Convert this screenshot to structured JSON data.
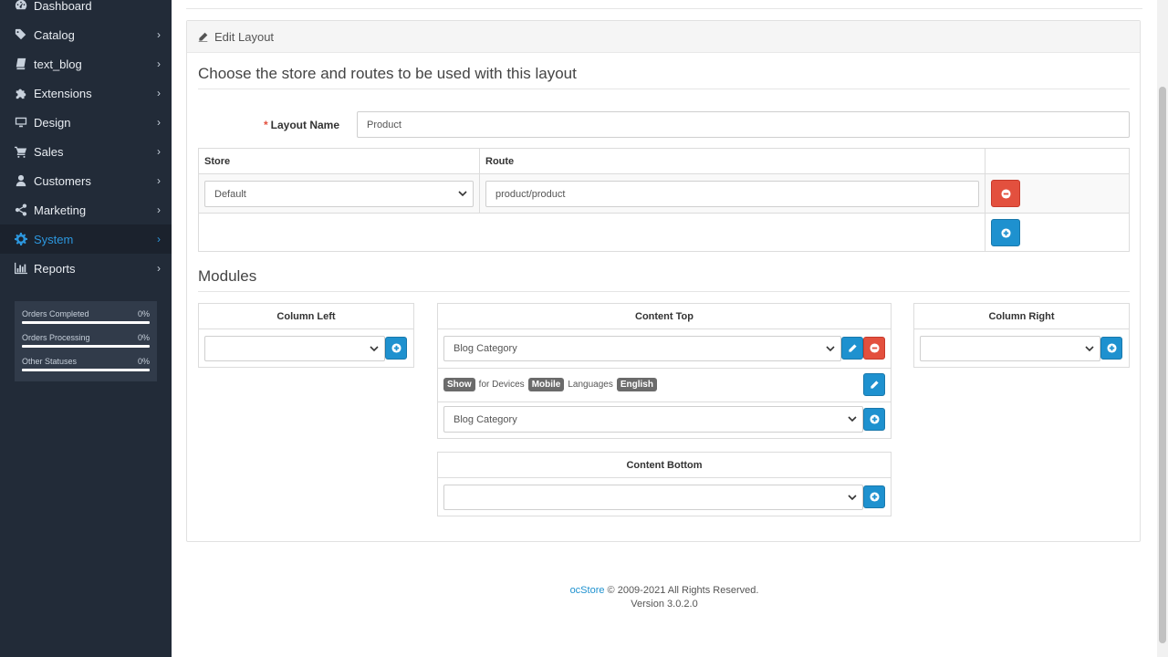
{
  "sidebar": {
    "items": [
      {
        "label": "Dashboard",
        "icon": "dashboard-icon",
        "chevron": false,
        "active": false
      },
      {
        "label": "Catalog",
        "icon": "tags-icon",
        "chevron": true,
        "active": false
      },
      {
        "label": "text_blog",
        "icon": "book-icon",
        "chevron": true,
        "active": false
      },
      {
        "label": "Extensions",
        "icon": "puzzle-icon",
        "chevron": true,
        "active": false
      },
      {
        "label": "Design",
        "icon": "desktop-icon",
        "chevron": true,
        "active": false
      },
      {
        "label": "Sales",
        "icon": "cart-icon",
        "chevron": true,
        "active": false
      },
      {
        "label": "Customers",
        "icon": "user-icon",
        "chevron": true,
        "active": false
      },
      {
        "label": "Marketing",
        "icon": "share-icon",
        "chevron": true,
        "active": false
      },
      {
        "label": "System",
        "icon": "gear-icon",
        "chevron": true,
        "active": true
      },
      {
        "label": "Reports",
        "icon": "bar-chart-icon",
        "chevron": true,
        "active": false
      }
    ],
    "stats": [
      {
        "label": "Orders Completed",
        "value": "0%",
        "progress": 0
      },
      {
        "label": "Orders Processing",
        "value": "0%",
        "progress": 0
      },
      {
        "label": "Other Statuses",
        "value": "0%",
        "progress": 0
      }
    ],
    "chevron_glyph": "›"
  },
  "panel": {
    "title": "Edit Layout",
    "legend_routes": "Choose the store and routes to be used with this layout",
    "layout_name_label": "Layout Name",
    "layout_name_required": "*",
    "layout_name_value": "Product",
    "routes_table": {
      "headers": {
        "store": "Store",
        "route": "Route"
      },
      "rows": [
        {
          "store": "Default",
          "route": "product/product"
        }
      ]
    },
    "legend_modules": "Modules",
    "modules": {
      "column_left": {
        "title": "Column Left",
        "select_value": ""
      },
      "content_top": {
        "title": "Content Top",
        "selected_module": "Blog Category",
        "show_label": "Show",
        "for_devices_text": "for Devices",
        "device_badge": "Mobile",
        "languages_text": "Languages",
        "language_badge": "English",
        "add_select_value": "Blog Category"
      },
      "column_right": {
        "title": "Column Right",
        "select_value": ""
      },
      "content_bottom": {
        "title": "Content Bottom",
        "select_value": ""
      }
    }
  },
  "footer": {
    "brand": "ocStore",
    "copyright": "© 2009-2021 All Rights Reserved.",
    "version": "Version 3.0.2.0"
  },
  "colors": {
    "sidebar_bg": "#222b38",
    "active_accent": "#2c97de",
    "primary_button": "#1e91cf",
    "danger_button": "#e3503e"
  }
}
